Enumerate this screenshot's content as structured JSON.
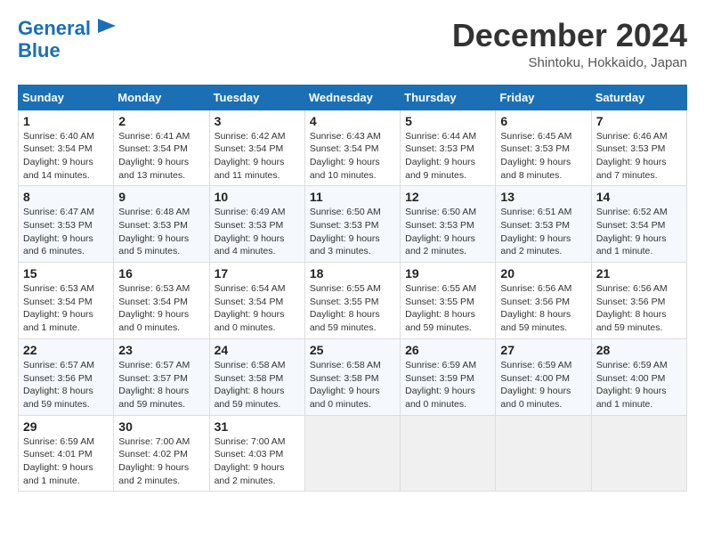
{
  "header": {
    "logo_line1": "General",
    "logo_line2": "Blue",
    "month_title": "December 2024",
    "location": "Shintoku, Hokkaido, Japan"
  },
  "days_of_week": [
    "Sunday",
    "Monday",
    "Tuesday",
    "Wednesday",
    "Thursday",
    "Friday",
    "Saturday"
  ],
  "weeks": [
    [
      {
        "day": "1",
        "sunrise": "6:40 AM",
        "sunset": "3:54 PM",
        "daylight": "9 hours and 14 minutes."
      },
      {
        "day": "2",
        "sunrise": "6:41 AM",
        "sunset": "3:54 PM",
        "daylight": "9 hours and 13 minutes."
      },
      {
        "day": "3",
        "sunrise": "6:42 AM",
        "sunset": "3:54 PM",
        "daylight": "9 hours and 11 minutes."
      },
      {
        "day": "4",
        "sunrise": "6:43 AM",
        "sunset": "3:54 PM",
        "daylight": "9 hours and 10 minutes."
      },
      {
        "day": "5",
        "sunrise": "6:44 AM",
        "sunset": "3:53 PM",
        "daylight": "9 hours and 9 minutes."
      },
      {
        "day": "6",
        "sunrise": "6:45 AM",
        "sunset": "3:53 PM",
        "daylight": "9 hours and 8 minutes."
      },
      {
        "day": "7",
        "sunrise": "6:46 AM",
        "sunset": "3:53 PM",
        "daylight": "9 hours and 7 minutes."
      }
    ],
    [
      {
        "day": "8",
        "sunrise": "6:47 AM",
        "sunset": "3:53 PM",
        "daylight": "9 hours and 6 minutes."
      },
      {
        "day": "9",
        "sunrise": "6:48 AM",
        "sunset": "3:53 PM",
        "daylight": "9 hours and 5 minutes."
      },
      {
        "day": "10",
        "sunrise": "6:49 AM",
        "sunset": "3:53 PM",
        "daylight": "9 hours and 4 minutes."
      },
      {
        "day": "11",
        "sunrise": "6:50 AM",
        "sunset": "3:53 PM",
        "daylight": "9 hours and 3 minutes."
      },
      {
        "day": "12",
        "sunrise": "6:50 AM",
        "sunset": "3:53 PM",
        "daylight": "9 hours and 2 minutes."
      },
      {
        "day": "13",
        "sunrise": "6:51 AM",
        "sunset": "3:53 PM",
        "daylight": "9 hours and 2 minutes."
      },
      {
        "day": "14",
        "sunrise": "6:52 AM",
        "sunset": "3:54 PM",
        "daylight": "9 hours and 1 minute."
      }
    ],
    [
      {
        "day": "15",
        "sunrise": "6:53 AM",
        "sunset": "3:54 PM",
        "daylight": "9 hours and 1 minute."
      },
      {
        "day": "16",
        "sunrise": "6:53 AM",
        "sunset": "3:54 PM",
        "daylight": "9 hours and 0 minutes."
      },
      {
        "day": "17",
        "sunrise": "6:54 AM",
        "sunset": "3:54 PM",
        "daylight": "9 hours and 0 minutes."
      },
      {
        "day": "18",
        "sunrise": "6:55 AM",
        "sunset": "3:55 PM",
        "daylight": "8 hours and 59 minutes."
      },
      {
        "day": "19",
        "sunrise": "6:55 AM",
        "sunset": "3:55 PM",
        "daylight": "8 hours and 59 minutes."
      },
      {
        "day": "20",
        "sunrise": "6:56 AM",
        "sunset": "3:56 PM",
        "daylight": "8 hours and 59 minutes."
      },
      {
        "day": "21",
        "sunrise": "6:56 AM",
        "sunset": "3:56 PM",
        "daylight": "8 hours and 59 minutes."
      }
    ],
    [
      {
        "day": "22",
        "sunrise": "6:57 AM",
        "sunset": "3:56 PM",
        "daylight": "8 hours and 59 minutes."
      },
      {
        "day": "23",
        "sunrise": "6:57 AM",
        "sunset": "3:57 PM",
        "daylight": "8 hours and 59 minutes."
      },
      {
        "day": "24",
        "sunrise": "6:58 AM",
        "sunset": "3:58 PM",
        "daylight": "8 hours and 59 minutes."
      },
      {
        "day": "25",
        "sunrise": "6:58 AM",
        "sunset": "3:58 PM",
        "daylight": "9 hours and 0 minutes."
      },
      {
        "day": "26",
        "sunrise": "6:59 AM",
        "sunset": "3:59 PM",
        "daylight": "9 hours and 0 minutes."
      },
      {
        "day": "27",
        "sunrise": "6:59 AM",
        "sunset": "4:00 PM",
        "daylight": "9 hours and 0 minutes."
      },
      {
        "day": "28",
        "sunrise": "6:59 AM",
        "sunset": "4:00 PM",
        "daylight": "9 hours and 1 minute."
      }
    ],
    [
      {
        "day": "29",
        "sunrise": "6:59 AM",
        "sunset": "4:01 PM",
        "daylight": "9 hours and 1 minute."
      },
      {
        "day": "30",
        "sunrise": "7:00 AM",
        "sunset": "4:02 PM",
        "daylight": "9 hours and 2 minutes."
      },
      {
        "day": "31",
        "sunrise": "7:00 AM",
        "sunset": "4:03 PM",
        "daylight": "9 hours and 2 minutes."
      },
      null,
      null,
      null,
      null
    ]
  ],
  "labels": {
    "sunrise": "Sunrise:",
    "sunset": "Sunset:",
    "daylight": "Daylight:"
  }
}
